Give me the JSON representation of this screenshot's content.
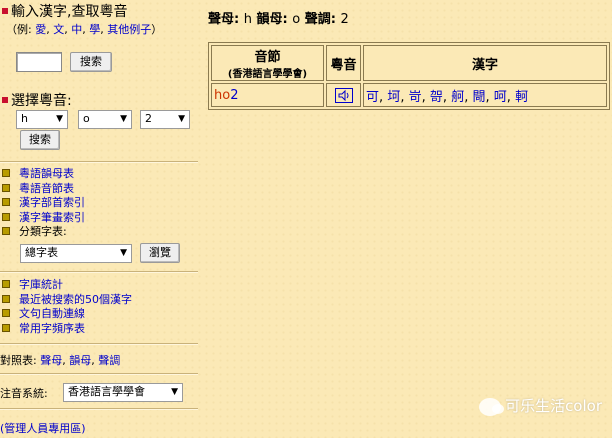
{
  "sidebar": {
    "section1": {
      "title": "輸入漢字,查取粵音",
      "example_prefix": "（例:",
      "examples": [
        "愛",
        "文",
        "中",
        "學",
        "其他例子"
      ],
      "example_suffix": "）",
      "search_value": "",
      "search_button": "搜索"
    },
    "section2": {
      "title": "選擇粵音:",
      "initial": "h",
      "final": "o",
      "tone": "2",
      "search_button": "搜索"
    },
    "links1": [
      {
        "label": "粵語韻母表"
      },
      {
        "label": "粵語音節表"
      },
      {
        "label": "漢字部首索引"
      },
      {
        "label": "漢字筆畫索引"
      }
    ],
    "category": {
      "label": "分類字表:",
      "selected": "總字表",
      "browse_button": "瀏覽"
    },
    "links2": [
      {
        "label": "字庫統計"
      },
      {
        "label": "最近被搜索的50個漢字"
      },
      {
        "label": "文句自動連線"
      },
      {
        "label": "常用字頻序表"
      }
    ],
    "compare": {
      "prefix": "對照表:",
      "links": [
        "聲母",
        "韻母",
        "聲調"
      ]
    },
    "system": {
      "label": "注音系統:",
      "selected": "香港語言學學會"
    },
    "admin": "(管理人員專用區)"
  },
  "main": {
    "info": {
      "initial_label": "聲母:",
      "initial_value": "h",
      "final_label": "韻母:",
      "final_value": "o",
      "tone_label": "聲調:",
      "tone_value": "2"
    },
    "table": {
      "header_syllable": "音節",
      "header_syllable_sub": "(香港語言學學會)",
      "header_audio": "粵音",
      "header_chars": "漢字",
      "syllable_initial": "ho",
      "syllable_tone": "2",
      "characters": [
        "可",
        "坷",
        "岢",
        "哿",
        "舸",
        "閜",
        "呵",
        "軻"
      ]
    }
  },
  "watermark": "可乐生活color",
  "colors": {
    "background": "#fbe9b6",
    "link": "#0000cc",
    "accent_red": "#c8102e",
    "syllable_initial": "#cc3300"
  },
  "icons": {
    "audio": "speaker-icon",
    "section_marker": "red-square-icon",
    "bullet": "olive-square-bullet-icon"
  }
}
